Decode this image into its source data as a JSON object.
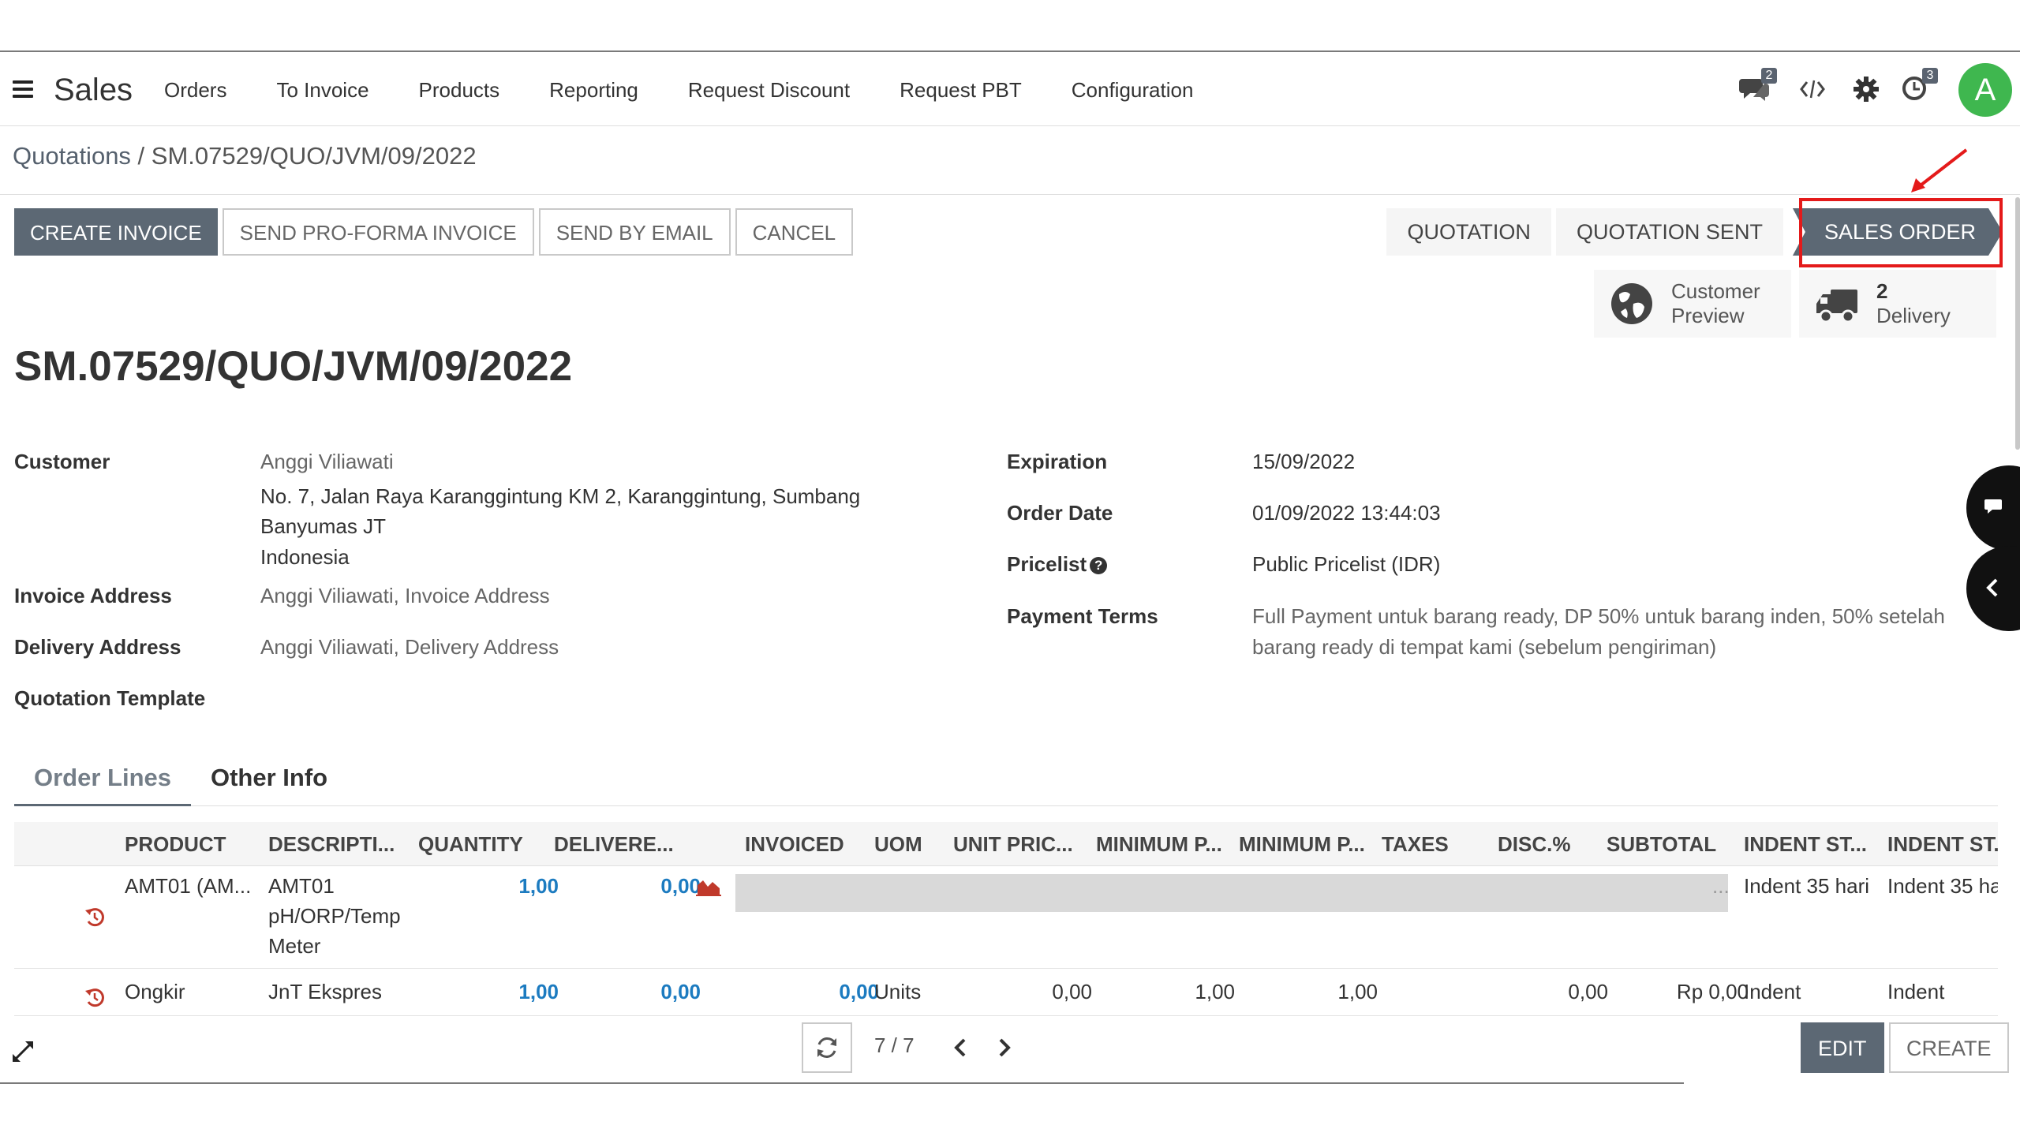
{
  "app": {
    "name": "Sales",
    "menu": [
      "Orders",
      "To Invoice",
      "Products",
      "Reporting",
      "Request Discount",
      "Request PBT",
      "Configuration"
    ],
    "messages_count": "2",
    "activities_count": "3",
    "avatar_letter": "A",
    "icons": [
      "menu-hamburger",
      "chat-bubbles",
      "code-brackets",
      "gear",
      "clock",
      "user-avatar"
    ]
  },
  "breadcrumb": {
    "parent": "Quotations",
    "separator": " / ",
    "current": "SM.07529/QUO/JVM/09/2022"
  },
  "actions": {
    "create_invoice": "CREATE INVOICE",
    "send_proforma": "SEND PRO-FORMA INVOICE",
    "send_email": "SEND BY EMAIL",
    "cancel": "CANCEL"
  },
  "stages": [
    {
      "label": "QUOTATION",
      "active": false
    },
    {
      "label": "QUOTATION SENT",
      "active": false
    },
    {
      "label": "SALES ORDER",
      "active": true
    }
  ],
  "smart_buttons": {
    "customer_preview": {
      "line1": "Customer",
      "line2": "Preview",
      "icon": "globe-icon"
    },
    "delivery": {
      "count": "2",
      "label": "Delivery",
      "icon": "truck-icon"
    }
  },
  "title": "SM.07529/QUO/JVM/09/2022",
  "fields_left": {
    "customer_label": "Customer",
    "customer_name": "Anggi Viliawati",
    "customer_addr1": "No. 7, Jalan Raya Karanggintung KM 2, Karanggintung, Sumbang",
    "customer_addr2": "Banyumas JT",
    "customer_addr3": "Indonesia",
    "invoice_label": "Invoice Address",
    "invoice_value": "Anggi Viliawati, Invoice Address",
    "delivery_label": "Delivery Address",
    "delivery_value": "Anggi Viliawati, Delivery Address",
    "template_label": "Quotation Template"
  },
  "fields_right": {
    "expiration_label": "Expiration",
    "expiration_value": "15/09/2022",
    "order_date_label": "Order Date",
    "order_date_value": "01/09/2022 13:44:03",
    "pricelist_label": "Pricelist",
    "pricelist_help": "?",
    "pricelist_value": "Public Pricelist (IDR)",
    "payment_terms_label": "Payment Terms",
    "payment_terms_line1": "Full Payment untuk barang ready, DP 50% untuk barang inden, 50% setelah",
    "payment_terms_line2": "barang ready di tempat kami (sebelum pengiriman)"
  },
  "tabs": [
    "Order Lines",
    "Other Info"
  ],
  "table": {
    "headers": [
      "PRODUCT",
      "DESCRIPTI...",
      "QUANTITY",
      "DELIVERE...",
      "INVOICED",
      "UOM",
      "UNIT PRIC...",
      "MINIMUM P...",
      "MINIMUM P...",
      "TAXES",
      "DISC.%",
      "SUBTOTAL",
      "INDENT ST...",
      "INDENT ST."
    ],
    "rows": [
      {
        "product": "AMT01 (AM...",
        "desc1": "AMT01",
        "desc2": "pH/ORP/Temp",
        "desc3": "Meter",
        "quantity": "1,00",
        "delivered": "0,00",
        "indent1": "Indent 35 hari",
        "indent2": "Indent 35 ha",
        "ellipsis": "..."
      },
      {
        "product": "Ongkir",
        "desc1": "JnT Ekspres",
        "quantity": "1,00",
        "delivered": "0,00",
        "invoiced": "0,00",
        "uom": "Units",
        "unit_price": "0,00",
        "min1": "1,00",
        "min2": "1,00",
        "disc": "0,00",
        "subtotal": "Rp 0,00",
        "indent1": "Indent",
        "indent2": "Indent"
      }
    ]
  },
  "pager": {
    "value": "7 / 7"
  },
  "footer": {
    "edit": "EDIT",
    "create": "CREATE"
  },
  "colors": {
    "primary": "#5c6874",
    "link_blue": "#1c7bc0",
    "avatar": "#3fb74f",
    "highlight": "#e41a1a"
  }
}
